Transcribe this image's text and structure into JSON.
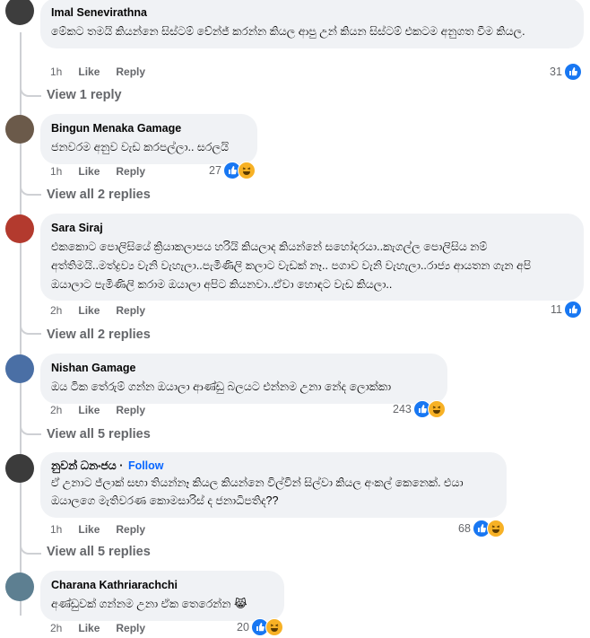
{
  "comments": [
    {
      "author": "Imal Senevirathna",
      "text": "මේකට තමයි කියන්නෙ සිස්ටම් චේන්ජ් කරන්න කියල ආපු උන් කියන සිස්ටම් එකටම අනුගත වීම කියල.",
      "time": "1h",
      "like": "Like",
      "reply": "Reply",
      "reactions": "31",
      "replies_link": "View 1 reply"
    },
    {
      "author": "Bingun Menaka Gamage",
      "text": "ජනවරම අනුව වැඩ කරපල්ලා.. සරලයි",
      "time": "1h",
      "like": "Like",
      "reply": "Reply",
      "reactions": "27",
      "replies_link": "View all 2 replies"
    },
    {
      "author": "Sara Siraj",
      "text": "එකකොට පොලිසියේ ක්‍රියාකලාපය හරියි කියලාද කියන්නේ සහෝදරයා..කැගල්ල පොලිසිය නම් අත්තිමයි..මත්ද්‍රව්‍ය වැනි වැහැලා..පැමිණිලි කලාට වැඩක් නෑ.. පගාව වැනි වැහැලා..රාජ්‍ය ආයතන ගැන අපි ඔයාලාට පැමිණිලි කරාම ඔයාලා අපිට කියනවා..ඒවා හොඳට වැඩ කියලා..",
      "time": "2h",
      "like": "Like",
      "reply": "Reply",
      "reactions": "11",
      "replies_link": "View all 2 replies"
    },
    {
      "author": "Nishan Gamage",
      "text": "ඔය ටික තේරුම් ගන්න ඔයාලා ආණ්ඩු බලයට එන්නම උනා නේද ලොක්කා",
      "time": "2h",
      "like": "Like",
      "reply": "Reply",
      "reactions": "243",
      "replies_link": "View all 5 replies"
    },
    {
      "author": "නුවන් ධනංජය",
      "follow": "Follow",
      "text": "ඒ උනාට ජ්ලාක් සභා තියන්නෑ කියල කියන්නෙ විල්වින් සිල්වා කියල අංකල් කෙනෙක්. එයා ඔයාලගෙ මැතිවරණ කොමසාරිස් ද ජනාධිපතිද??",
      "time": "1h",
      "like": "Like",
      "reply": "Reply",
      "reactions": "68",
      "replies_link": "View all 5 replies"
    },
    {
      "author": "Charana Kathriarachchi",
      "text": "අණ්ඩුවක් ගන්නම උනා ඒක තෙරෙන්න 😹",
      "time": "2h",
      "like": "Like",
      "reply": "Reply",
      "reactions": "20"
    }
  ]
}
